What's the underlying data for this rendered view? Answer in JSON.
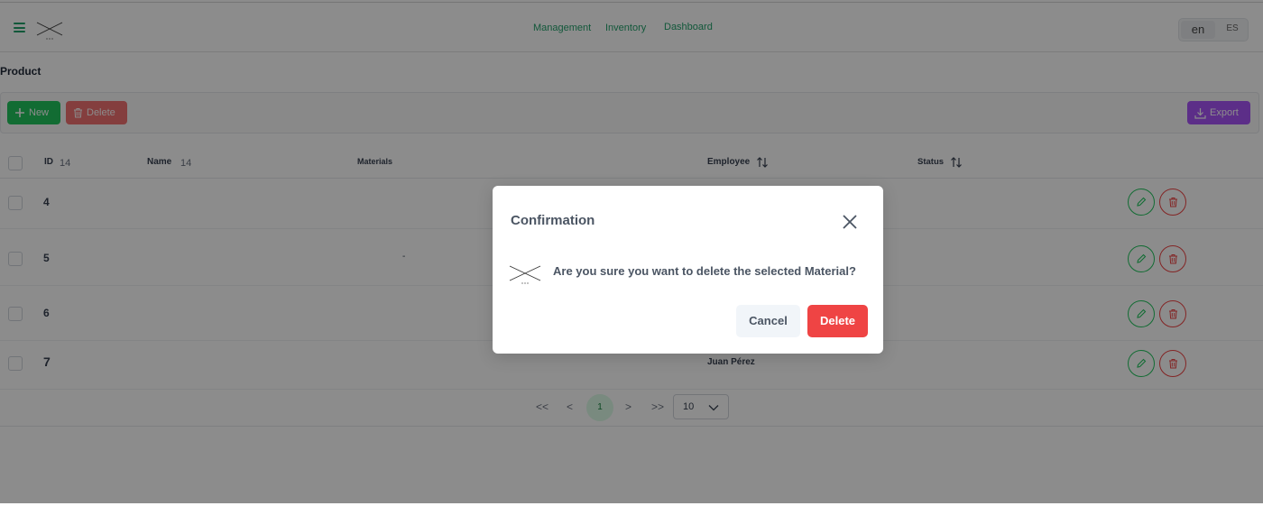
{
  "header": {
    "nav": [
      {
        "label": "Management"
      },
      {
        "label": "Inventory"
      },
      {
        "label": "Dashboard"
      }
    ],
    "lang_active": "en",
    "lang_other": "ES"
  },
  "page": {
    "title": "Product"
  },
  "toolbar": {
    "new_label": "New",
    "delete_label": "Delete",
    "export_label": "Export"
  },
  "table": {
    "columns": {
      "id": "ID",
      "id_badge": "14",
      "name": "Name",
      "name_badge": "14",
      "materials": "Materials",
      "employee": "Employee",
      "status": "Status"
    },
    "rows": [
      {
        "id": "4",
        "materials": "",
        "employee": ""
      },
      {
        "id": "5",
        "materials": "-",
        "employee": ""
      },
      {
        "id": "6",
        "materials": "",
        "employee": ""
      },
      {
        "id": "7",
        "materials": "",
        "employee": "Juan Pérez"
      }
    ]
  },
  "pagination": {
    "first": "<<",
    "prev": "<",
    "current_page": "1",
    "next": ">",
    "last": ">>",
    "rows_per_page": "10"
  },
  "dialog": {
    "title": "Confirmation",
    "message": "Are you sure you want to delete the selected Material?",
    "cancel_label": "Cancel",
    "confirm_label": "Delete"
  },
  "colors": {
    "accent": "#22c55e",
    "danger": "#ef4444",
    "export": "#a855f7"
  }
}
